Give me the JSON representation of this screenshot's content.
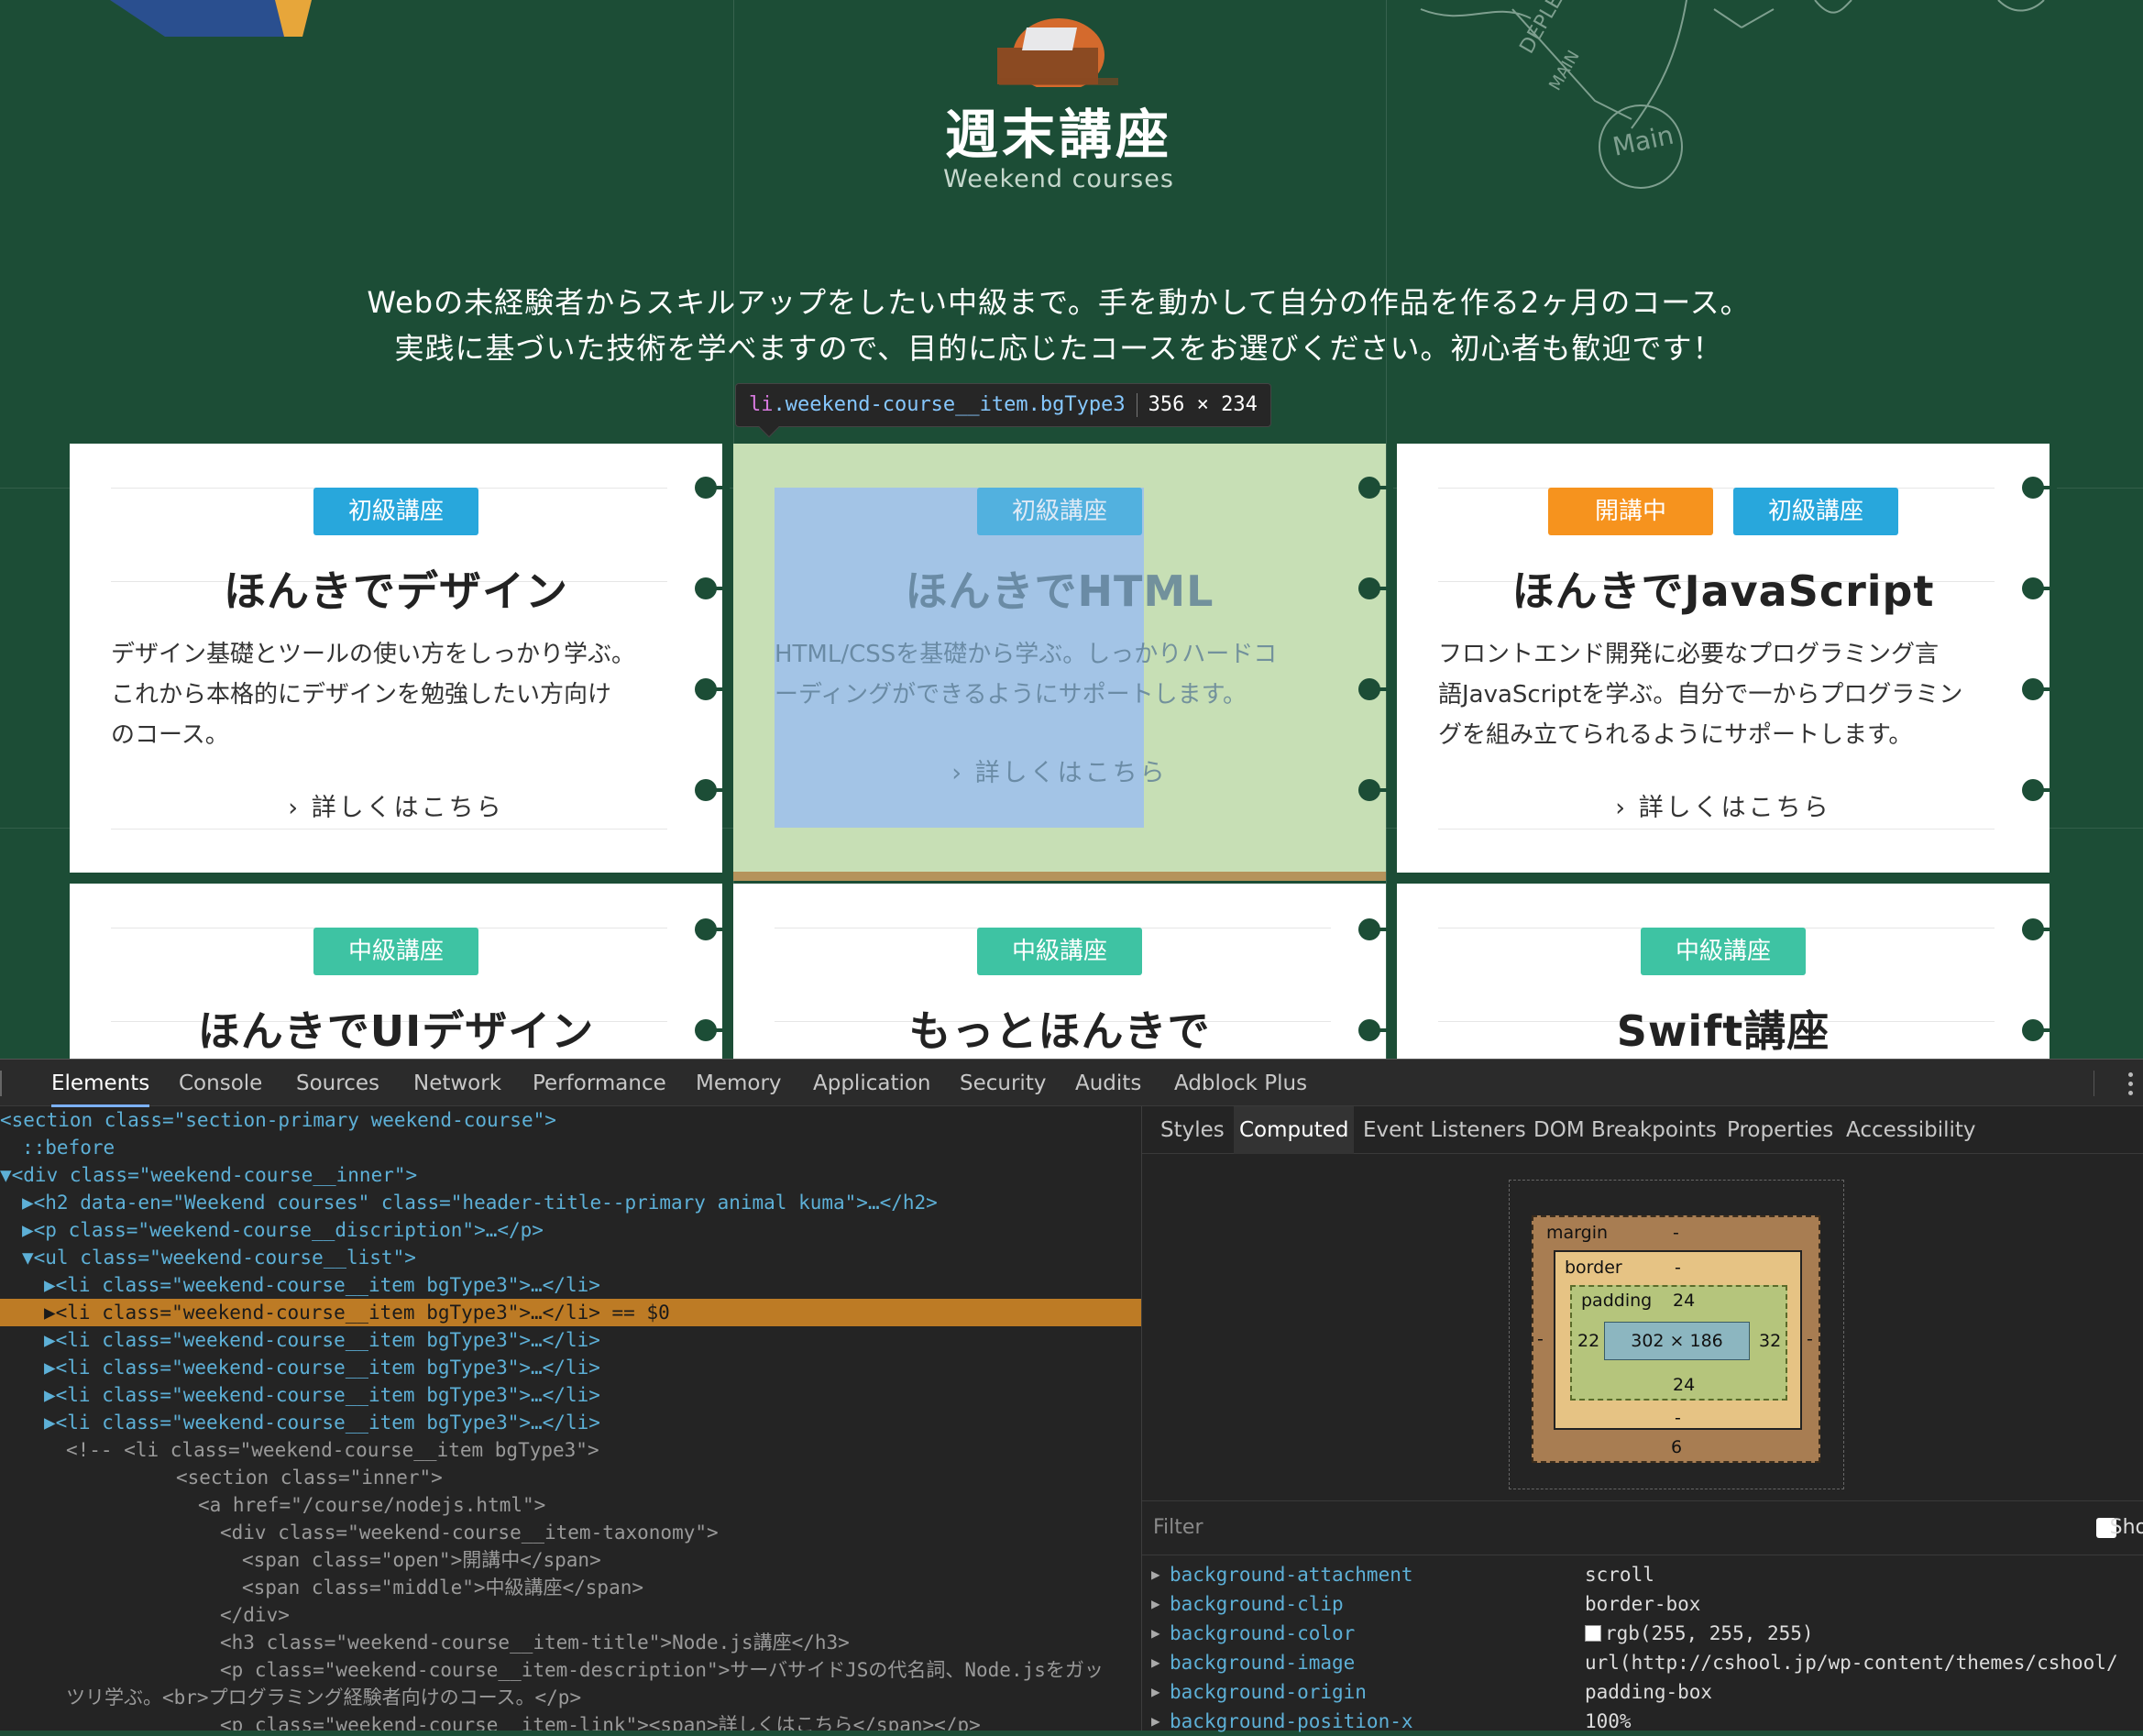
{
  "hero": {
    "title": "週末講座",
    "subtitle": "Weekend courses",
    "desc_line1": "Webの未経験者からスキルアップをしたい中級まで。手を動かして自分の作品を作る2ヶ月のコース。",
    "desc_line2": "実践に基づいた技術を学べますので、目的に応じたコースをお選びください。初心者も歓迎です！"
  },
  "tooltip": {
    "tag": "li",
    "classes": ".weekend-course__item.bgType3",
    "size": "356 × 234"
  },
  "cards": [
    {
      "badges": [
        {
          "label": "初級講座",
          "color": "blue"
        }
      ],
      "title": "ほんきでデザイン",
      "desc": [
        "デザイン基礎とツールの使い方をしっかり学ぶ。",
        "これから本格的にデザインを勉強したい方向け",
        "のコース。"
      ],
      "link": "詳しくはこちら"
    },
    {
      "badges": [
        {
          "label": "初級講座",
          "color": "blue"
        }
      ],
      "title": "ほんきでHTML",
      "desc": [
        "HTML/CSSを基礎から学ぶ。しっかりハードコ",
        "ーディングができるようにサポートします。"
      ],
      "link": "詳しくはこちら"
    },
    {
      "badges": [
        {
          "label": "開講中",
          "color": "orange"
        },
        {
          "label": "初級講座",
          "color": "blue"
        }
      ],
      "title": "ほんきでJavaScript",
      "desc": [
        "フロントエンド開発に必要なプログラミング言",
        "語JavaScriptを学ぶ。自分で一からプログラミン",
        "グを組み立てられるようにサポートします。"
      ],
      "link": "詳しくはこちら"
    },
    {
      "badges": [
        {
          "label": "中級講座",
          "color": "green"
        }
      ],
      "title": "ほんきでUIデザイン"
    },
    {
      "badges": [
        {
          "label": "中級講座",
          "color": "green"
        }
      ],
      "title": "もっとほんきで"
    },
    {
      "badges": [
        {
          "label": "中級講座",
          "color": "green"
        }
      ],
      "title": "Swift講座"
    }
  ],
  "chalk_text": [
    "DEPLEE",
    "MAIN",
    "Main"
  ],
  "devtools": {
    "tabs": [
      "Elements",
      "Console",
      "Sources",
      "Network",
      "Performance",
      "Memory",
      "Application",
      "Security",
      "Audits",
      "Adblock Plus"
    ],
    "active_tab": "Elements",
    "dom_lines": [
      {
        "indent": 0,
        "text": "<section class=\"section-primary weekend-course\">"
      },
      {
        "indent": 1,
        "text": "::before"
      },
      {
        "indent": 0,
        "text": "▼<div class=\"weekend-course__inner\">"
      },
      {
        "indent": 1,
        "text": "▶<h2 data-en=\"Weekend courses\" class=\"header-title--primary animal kuma\">…</h2>"
      },
      {
        "indent": 1,
        "text": "▶<p class=\"weekend-course__discription\">…</p>"
      },
      {
        "indent": 1,
        "text": "▼<ul class=\"weekend-course__list\">"
      },
      {
        "indent": 2,
        "text": "▶<li class=\"weekend-course__item bgType3\">…</li>"
      },
      {
        "indent": 2,
        "text": "▶<li class=\"weekend-course__item bgType3\">…</li> == $0",
        "selected": true
      },
      {
        "indent": 2,
        "text": "▶<li class=\"weekend-course__item bgType3\">…</li>"
      },
      {
        "indent": 2,
        "text": "▶<li class=\"weekend-course__item bgType3\">…</li>"
      },
      {
        "indent": 2,
        "text": "▶<li class=\"weekend-course__item bgType3\">…</li>"
      },
      {
        "indent": 2,
        "text": "▶<li class=\"weekend-course__item bgType3\">…</li>"
      },
      {
        "indent": 3,
        "text": "<!-- <li class=\"weekend-course__item bgType3\">",
        "comment": true
      },
      {
        "indent": 8,
        "text": "<section class=\"inner\">",
        "comment": true
      },
      {
        "indent": 9,
        "text": "<a href=\"/course/nodejs.html\">",
        "comment": true
      },
      {
        "indent": 10,
        "text": "<div class=\"weekend-course__item-taxonomy\">",
        "comment": true
      },
      {
        "indent": 11,
        "text": "<span class=\"open\">開講中</span>",
        "comment": true
      },
      {
        "indent": 11,
        "text": "<span class=\"middle\">中級講座</span>",
        "comment": true
      },
      {
        "indent": 10,
        "text": "</div>",
        "comment": true
      },
      {
        "indent": 10,
        "text": "<h3 class=\"weekend-course__item-title\">Node.js講座</h3>",
        "comment": true
      },
      {
        "indent": 10,
        "text": "<p class=\"weekend-course__item-description\">サーバサイドJSの代名詞、Node.jsをガッ",
        "comment": true
      },
      {
        "indent": 3,
        "text": "ツリ学ぶ。<br>プログラミング経験者向けのコース。</p>",
        "comment": true
      },
      {
        "indent": 10,
        "text": "<p class=\"weekend-course__item-link\"><span>詳しくはこちら</span></p>",
        "comment": true
      }
    ],
    "side_tabs": [
      "Styles",
      "Computed",
      "Event Listeners",
      "DOM Breakpoints",
      "Properties",
      "Accessibility"
    ],
    "side_active": "Computed",
    "box_model": {
      "margin_label": "margin",
      "margin_top": "-",
      "margin_bottom": "6",
      "margin_left": "-",
      "margin_right": "-",
      "border_label": "border",
      "border_top": "-",
      "border_bottom": "-",
      "padding_label": "padding",
      "padding_top": "24",
      "padding_bottom": "24",
      "padding_left": "22",
      "padding_right": "32",
      "content": "302 × 186"
    },
    "filter_placeholder": "Filter",
    "show_label": "Sho",
    "computed": [
      {
        "name": "background-attachment",
        "value": "scroll"
      },
      {
        "name": "background-clip",
        "value": "border-box"
      },
      {
        "name": "background-color",
        "value": "rgb(255, 255, 255)",
        "swatch": "#ffffff"
      },
      {
        "name": "background-image",
        "value": "url(http://cshool.jp/wp-content/themes/cshool/"
      },
      {
        "name": "background-origin",
        "value": "padding-box"
      },
      {
        "name": "background-position-x",
        "value": "100%"
      }
    ]
  },
  "colors": {
    "page_bg": "#1c4d36",
    "badge_blue": "#28a7dc",
    "badge_orange": "#f6931e",
    "badge_green": "#3ec3a3",
    "highlight_margin": "#c7dfb5",
    "highlight_padding": "#a3c4e6"
  }
}
